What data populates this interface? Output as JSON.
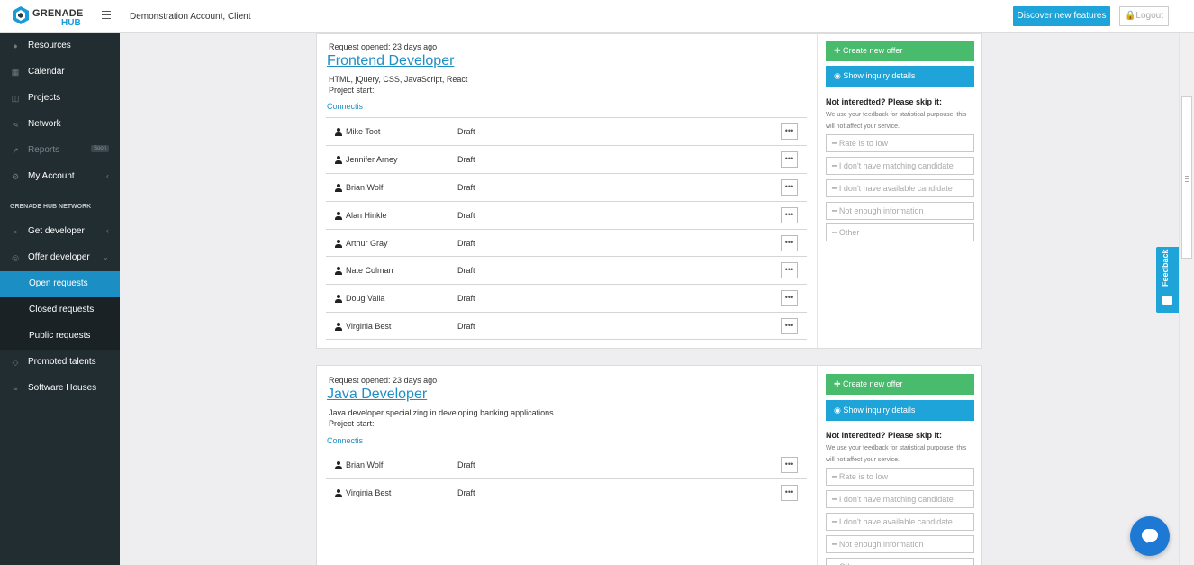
{
  "header": {
    "logo_top": "GRENADE",
    "logo_bottom": "HUB",
    "account": "Demonstration Account, Client",
    "discover_label": "Discover new features",
    "logout_label": "Logout"
  },
  "sidebar": {
    "items": [
      {
        "label": "Resources",
        "icon": "users-icon"
      },
      {
        "label": "Calendar",
        "icon": "calendar-icon"
      },
      {
        "label": "Projects",
        "icon": "projects-icon"
      },
      {
        "label": "Network",
        "icon": "share-icon"
      },
      {
        "label": "Reports",
        "icon": "chart-icon",
        "badge": "Soon"
      },
      {
        "label": "My Account",
        "icon": "account-icon"
      }
    ],
    "section_heading": "GRENADE HUB NETWORK",
    "network_items": [
      {
        "label": "Get developer",
        "icon": "search-icon"
      },
      {
        "label": "Offer developer",
        "icon": "check-circle-icon"
      }
    ],
    "sub_items": [
      {
        "label": "Open requests",
        "active": true
      },
      {
        "label": "Closed requests"
      },
      {
        "label": "Public requests"
      }
    ],
    "bottom_items": [
      {
        "label": "Promoted talents",
        "icon": "diamond-icon"
      },
      {
        "label": "Software Houses",
        "icon": "list-icon"
      }
    ]
  },
  "requests": [
    {
      "opened": "Request opened: 23 days ago",
      "title": "Frontend Developer",
      "description": "HTML, jQuery, CSS, JavaScript, React",
      "start": "Project start:",
      "company": "Connectis",
      "candidates": [
        {
          "name": "Mike Toot",
          "status": "Draft"
        },
        {
          "name": "Jennifer Arney",
          "status": "Draft"
        },
        {
          "name": "Brian Wolf",
          "status": "Draft"
        },
        {
          "name": "Alan Hinkle",
          "status": "Draft"
        },
        {
          "name": "Arthur Gray",
          "status": "Draft"
        },
        {
          "name": "Nate Colman",
          "status": "Draft"
        },
        {
          "name": "Doug Valla",
          "status": "Draft"
        },
        {
          "name": "Virginia Best",
          "status": "Draft"
        }
      ]
    },
    {
      "opened": "Request opened: 23 days ago",
      "title": "Java Developer",
      "description": "Java developer specializing in developing banking applications",
      "start": "Project start:",
      "company": "Connectis",
      "candidates": [
        {
          "name": "Brian Wolf",
          "status": "Draft"
        },
        {
          "name": "Virginia Best",
          "status": "Draft"
        }
      ]
    }
  ],
  "actions": {
    "create_offer": "Create new offer",
    "show_details": "Show inquiry details",
    "skip_title": "Not interedted? Please skip it:",
    "skip_note": "We use your feedback for statistical purpouse, this will not affect your service.",
    "reasons": [
      "Rate is to low",
      "I don't have matching candidate",
      "I don't have available candidate",
      "Not enough information",
      "Other"
    ],
    "more_glyph": "•••"
  },
  "feedback_label": "Feedback",
  "colors": {
    "accent": "#1ea4d9",
    "success": "#48bb6c",
    "sidebar_bg": "#222d32",
    "active_nav": "#1b8fc4"
  }
}
